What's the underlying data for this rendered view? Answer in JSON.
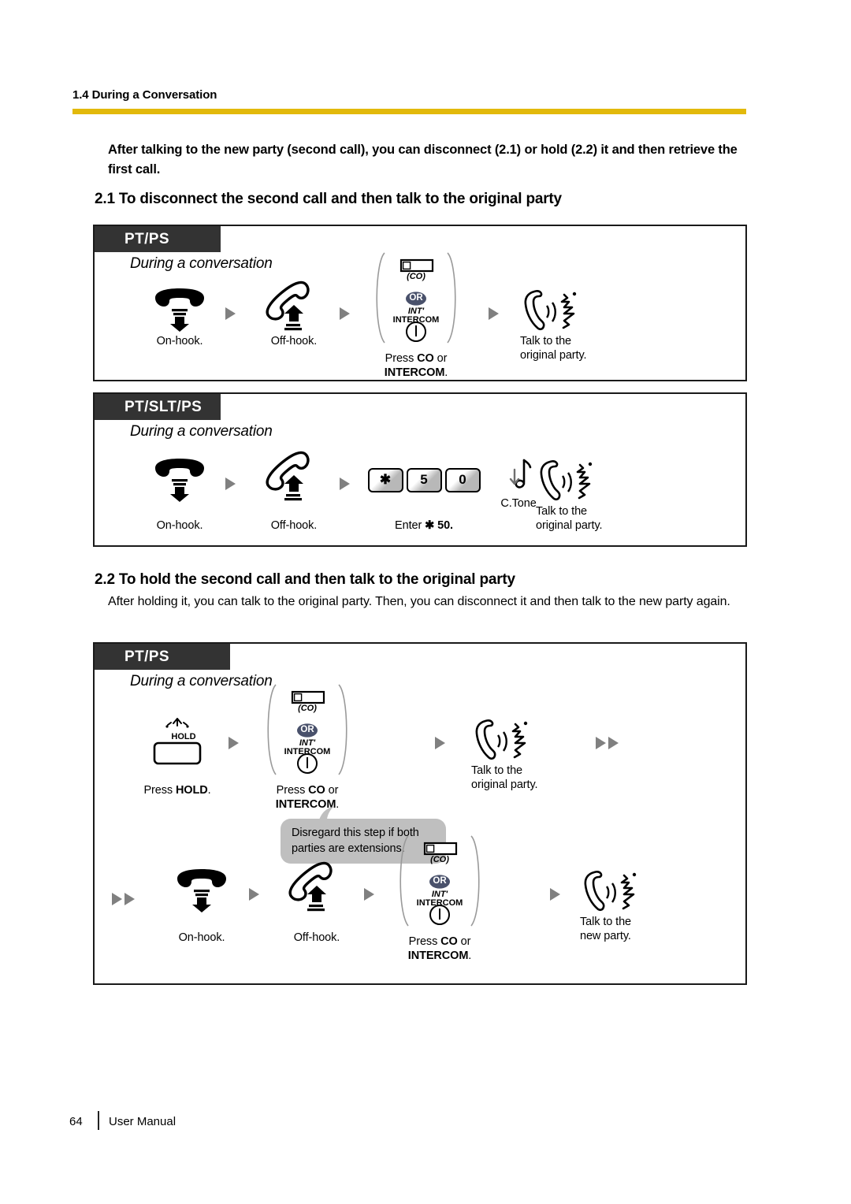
{
  "page": {
    "running_header": "1.4 During a Conversation",
    "rule_color": "#E2B90B",
    "intro": "After talking to the new party (second call), you can disconnect (2.1) or hold (2.2) it and then retrieve the first call.",
    "footer": {
      "page_number": "64",
      "label": "User Manual"
    }
  },
  "sections": [
    {
      "heading": "2.1 To disconnect the second call and then talk to the original party",
      "body": "",
      "boxes": [
        {
          "tag": "PT/PS",
          "context": "During a conversation",
          "steps": [
            {
              "icon": "on-hook-handset-icon",
              "caption": "On-hook."
            },
            {
              "icon": "off-hook-handset-icon",
              "caption": "Off-hook."
            },
            {
              "icon": "co-intercom-button-group-icon",
              "co_label": "(CO)",
              "or_label": "OR",
              "int_label": "INT'",
              "intercom_label": "INTERCOM",
              "caption_line1_pre": "Press ",
              "caption_line1_bold": "CO",
              "caption_line1_post": " or",
              "caption_line2_bold": "INTERCOM",
              "caption_line2_post": "."
            },
            {
              "icon": "talk-to-party-icon",
              "caption": "Talk to the\noriginal party."
            }
          ]
        },
        {
          "tag": "PT/SLT/PS",
          "context": "During a conversation",
          "steps": [
            {
              "icon": "on-hook-handset-icon",
              "caption": "On-hook."
            },
            {
              "icon": "off-hook-handset-icon",
              "caption": "Off-hook."
            },
            {
              "icon": "keypad-keys-icon",
              "keys": [
                "✱",
                "5",
                "0"
              ],
              "caption_pre": "Enter ",
              "caption_bold": "✱ 50."
            },
            {
              "icon": "confirmation-tone-icon",
              "tone_label": "C.Tone"
            },
            {
              "icon": "talk-to-party-icon",
              "caption": "Talk to the\noriginal party."
            }
          ]
        }
      ]
    },
    {
      "heading": "2.2 To hold the second call and then talk to the original party",
      "body": "After holding it, you can talk to the original party. Then, you can disconnect it and then talk to the new party again.",
      "boxes": [
        {
          "tag": "PT/PS",
          "context": "During a conversation",
          "bubble": "Disregard this step if both parties are extensions.",
          "row1": [
            {
              "icon": "hold-button-icon",
              "hold_label": "HOLD",
              "caption_pre": "Press ",
              "caption_bold": "HOLD",
              "caption_post": "."
            },
            {
              "icon": "co-intercom-button-group-icon",
              "co_label": "(CO)",
              "or_label": "OR",
              "int_label": "INT'",
              "intercom_label": "INTERCOM",
              "caption_line1_pre": "Press ",
              "caption_line1_bold": "CO",
              "caption_line1_post": " or",
              "caption_line2_bold": "INTERCOM",
              "caption_line2_post": "."
            },
            {
              "icon": "talk-to-party-icon",
              "caption": "Talk to the\noriginal party."
            }
          ],
          "row2": [
            {
              "icon": "on-hook-handset-icon",
              "caption": "On-hook."
            },
            {
              "icon": "off-hook-handset-icon",
              "caption": "Off-hook."
            },
            {
              "icon": "co-intercom-button-group-icon",
              "co_label": "(CO)",
              "or_label": "OR",
              "int_label": "INT'",
              "intercom_label": "INTERCOM",
              "caption_line1_pre": "Press ",
              "caption_line1_bold": "CO",
              "caption_line1_post": " or",
              "caption_line2_bold": "INTERCOM",
              "caption_line2_post": "."
            },
            {
              "icon": "talk-to-party-icon",
              "caption": "Talk to the\nnew party."
            }
          ]
        }
      ]
    }
  ],
  "labels": {
    "on_hook": "On-hook.",
    "off_hook": "Off-hook.",
    "press": "Press ",
    "co": "CO",
    "or_text": " or",
    "intercom": "INTERCOM",
    "period": ".",
    "talk_line1": "Talk to the",
    "talk_original": "original party.",
    "talk_new": "new party.",
    "enter_pre": "Enter ",
    "enter_code": "✱ 50.",
    "ctone": "C.Tone",
    "hold": "HOLD",
    "co_paren": "(CO)",
    "or_badge": "OR",
    "int_tick": "INT'",
    "key_star": "✱",
    "key_5": "5",
    "key_0": "0",
    "bubble": "Disregard this step if both parties are extensions."
  }
}
